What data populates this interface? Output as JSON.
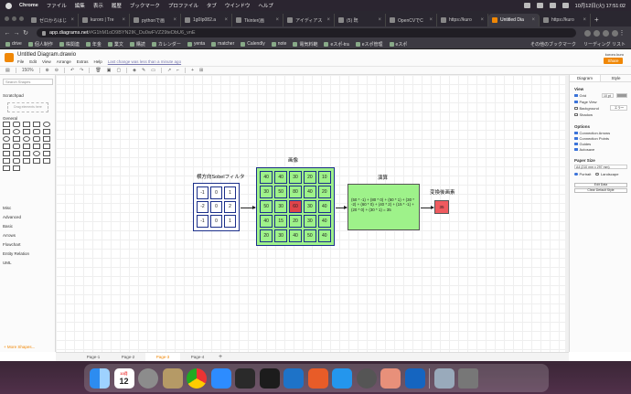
{
  "menubar": {
    "app": "Chrome",
    "items": [
      "ファイル",
      "編集",
      "表示",
      "履歴",
      "ブックマーク",
      "プロファイル",
      "タブ",
      "ウインドウ",
      "ヘルプ"
    ],
    "clock": "10月12日(火)  17:51:02"
  },
  "tabs": [
    {
      "label": "ゼロからはじ",
      "active": false
    },
    {
      "label": "kuroro | Tre",
      "active": false
    },
    {
      "label": "pythonで画",
      "active": false
    },
    {
      "label": "1g0Ip082.a",
      "active": false
    },
    {
      "label": "Tkinter(画",
      "active": false
    },
    {
      "label": "アイディアス",
      "active": false
    },
    {
      "label": "(5) 既",
      "active": false
    },
    {
      "label": "OpenCVでC",
      "active": false
    },
    {
      "label": "https://kuro",
      "active": false
    },
    {
      "label": "Untitled Dia",
      "active": true
    },
    {
      "label": "https://kuro",
      "active": false
    }
  ],
  "omnibox": {
    "host": "app.diagrams.net",
    "path": "/#G1hM1oD9BYN2IK_Du0wFVZ29teDbU6_vnE"
  },
  "bookmarks": {
    "items": [
      "drive",
      "個人制作",
      "株関連",
      "年金",
      "業文",
      "購読",
      "カレンダー",
      "yenta",
      "matcher",
      "Calendly",
      "note",
      "電気料範",
      "eスポ-tra",
      "eスポ管理",
      "eスポ"
    ],
    "others": "その他のブックマーク",
    "reading": "リーディング リスト"
  },
  "app": {
    "title": "Untitled Diagram.drawio",
    "menus": [
      "File",
      "Edit",
      "View",
      "Arrange",
      "Extras",
      "Help"
    ],
    "saved_msg": "Last change was less than a minute ago",
    "user": "kuroro.kuro",
    "share": "Share",
    "zoom": "150%"
  },
  "sidebar": {
    "search_placeholder": "Search Shapes",
    "scratchpad": "Scratchpad",
    "drop_hint": "Drag elements here",
    "general": "General",
    "sections": [
      "Misc",
      "Advanced",
      "Basic",
      "Arrows",
      "Flowchart",
      "Entity Relation",
      "UML"
    ],
    "more_shapes": "+ More Shapes..."
  },
  "panel": {
    "tabs": [
      "Diagram",
      "Style"
    ],
    "view": "View",
    "grid": "Grid",
    "grid_size": "10 pt",
    "page_view": "Page View",
    "background": "Background",
    "shadow": "Shadow",
    "edit_btn": "エラー",
    "options": "Options",
    "connection_arrows": "Connection Arrows",
    "connection_points": "Connection Points",
    "guides": "Guides",
    "autosave": "Autosave",
    "paper_size": "Paper Size",
    "paper_value": "A4 (210 mm x 297 mm)",
    "portrait": "Portrait",
    "landscape": "Landscape",
    "edit_data": "Edit Data",
    "clear_default": "Clear Default Style"
  },
  "pages": [
    {
      "label": "Page-1",
      "active": false
    },
    {
      "label": "Page-2",
      "active": false
    },
    {
      "label": "Page-3",
      "active": true
    },
    {
      "label": "Page-4",
      "active": false
    }
  ],
  "diagram": {
    "kernel_label": "横方向Sobelフィルタ",
    "kernel": [
      [
        "-1",
        "0",
        "1"
      ],
      [
        "-2",
        "0",
        "2"
      ],
      [
        "-1",
        "0",
        "1"
      ]
    ],
    "image_label": "画像",
    "image": [
      [
        "40",
        "40",
        "30",
        "20",
        "10"
      ],
      [
        "30",
        "50",
        "80",
        "40",
        "20"
      ],
      [
        "50",
        "30",
        "60",
        "30",
        "40"
      ],
      [
        "40",
        "15",
        "20",
        "30",
        "40"
      ],
      [
        "20",
        "30",
        "40",
        "50",
        "40"
      ]
    ],
    "highlight": [
      2,
      2
    ],
    "calc_label": "演算",
    "calc_text": "(50 * -1) + (80 * 0) + (50 * 1) + (30 * -2) + (60 * 0) + (40 * 2) + (15 * -1) + (20 * 0) + (30 * 1) = 35",
    "result_label": "変換後画素",
    "result": "35"
  },
  "dock": {
    "calendar_month": "10月",
    "calendar_day": "12",
    "apps": [
      "finder-icon",
      "calendar-icon",
      "system-preferences-icon",
      "notes-icon",
      "chrome-icon",
      "zoom-icon",
      "terminal-icon",
      "terminal2-icon",
      "vscode-icon",
      "grapher-icon",
      "docker-icon",
      "quicktime-icon",
      "preview-icon",
      "infinity-icon",
      "screenshot-icon",
      "trash-icon"
    ]
  }
}
